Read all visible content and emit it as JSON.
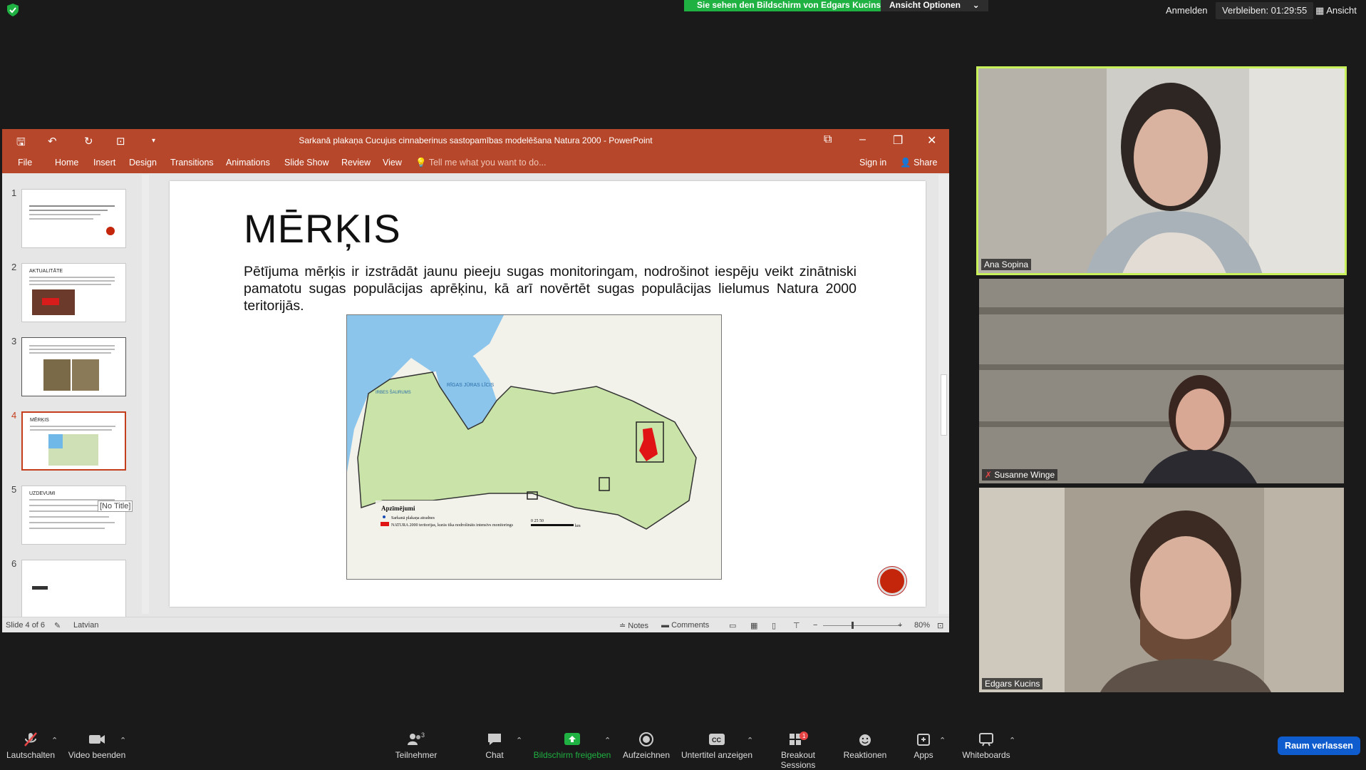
{
  "zoom": {
    "share_banner": "Sie sehen den Bildschirm von Edgars Kucins",
    "view_options": "Ansicht Optionen",
    "login": "Anmelden",
    "remaining": "Verbleiben: 01:29:55",
    "view": "Ansicht",
    "toolbar": {
      "mute": "Lautschalten",
      "video": "Video beenden",
      "participants": "Teilnehmer",
      "participants_count": "3",
      "chat": "Chat",
      "share": "Bildschirm freigeben",
      "record": "Aufzeichnen",
      "subtitles": "Untertitel anzeigen",
      "breakout": "Breakout Sessions",
      "breakout_badge": "1",
      "reactions": "Reaktionen",
      "apps": "Apps",
      "whiteboards": "Whiteboards",
      "leave": "Raum verlassen"
    },
    "participants": [
      {
        "name": "Ana Sopina"
      },
      {
        "name": "Susanne Winge"
      },
      {
        "name": "Edgars Kucins"
      }
    ]
  },
  "ppt": {
    "window_title": "Sarkanā plakaņa Cucujus cinnaberinus sastopamības modelēšana Natura 2000 - PowerPoint",
    "ribbon_tabs": [
      "File",
      "Home",
      "Insert",
      "Design",
      "Transitions",
      "Animations",
      "Slide Show",
      "Review",
      "View"
    ],
    "tell_me": "Tell me what you want to do...",
    "sign_in": "Sign in",
    "share": "Share",
    "thumbnails": [
      {
        "num": "1",
        "title": ""
      },
      {
        "num": "2",
        "title": "AKTUALITĀTE"
      },
      {
        "num": "3",
        "title": ""
      },
      {
        "num": "4",
        "title": "MĒRĶIS"
      },
      {
        "num": "5",
        "title": "UZDEVUMI"
      },
      {
        "num": "6",
        "title": ""
      }
    ],
    "tooltip": "[No Title]",
    "slide": {
      "title": "MĒRĶIS",
      "body": "Pētījuma mērķis ir izstrādāt jaunu pieeju sugas monitoringam, nodrošinot iespēju veikt zinātniski pamatotu sugas populācijas aprēķinu, kā arī novērtēt sugas populācijas lielumus Natura 2000 teritorijās.",
      "map_legend_title": "Apzīmējumi",
      "map_legend_item1": "Sarkanā plakaņa atradnes",
      "map_legend_item2": "NATURA 2000 teritorijas, kurās tika nodrošināts intensīvs monitorings",
      "map_scale": "0     25     50",
      "map_scale_unit": "km",
      "map_labels": [
        "RĪGAS JŪRAS LĪCIS",
        "IRBES ŠAURUMS"
      ]
    },
    "status": {
      "slide_of": "Slide 4 of 6",
      "language": "Latvian",
      "notes": "Notes",
      "comments": "Comments",
      "zoom": "80%"
    }
  }
}
